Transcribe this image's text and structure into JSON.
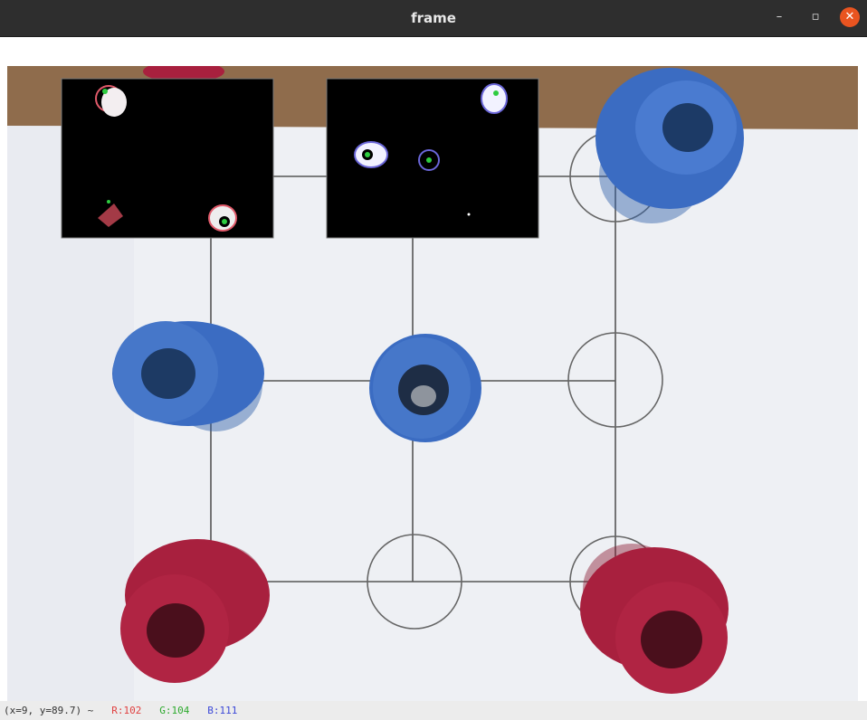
{
  "window": {
    "title": "frame",
    "minimize_icon": "minimize-icon",
    "maximize_icon": "maximize-icon",
    "close_icon": "close-icon"
  },
  "controls": {
    "minimize": "–",
    "maximize": "▫",
    "close": "✕"
  },
  "status": {
    "coords": "(x=9, y=89.7) ~",
    "r": "R:102",
    "g": "G:104",
    "b": "B:111"
  },
  "colors": {
    "titlebar": "#2e2e2e",
    "close_button": "#e95420",
    "blue_piece": "#3f6fc0",
    "red_piece": "#a8203e",
    "board": "#eef0f4",
    "table": "#9c7b5a"
  }
}
